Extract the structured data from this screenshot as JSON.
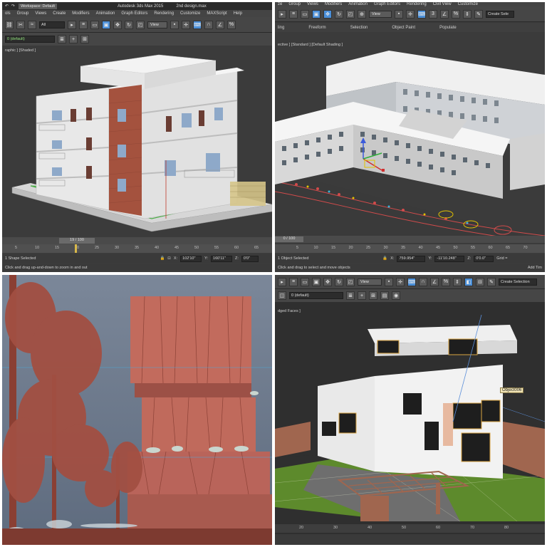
{
  "colors": {
    "viewport_bg": "#3b3b3b",
    "accent": "#4a8fd9",
    "time_slider": "#d8b84a",
    "brick": "#a4523e",
    "render_tint": "#c26b5d"
  },
  "panel1": {
    "workspace": "Workspace: Default",
    "app_title": "Autodesk 3ds Max  2015",
    "file_name": "2nd design.max",
    "menus": [
      "ols",
      "Group",
      "Views",
      "Create",
      "Modifiers",
      "Animation",
      "Graph Editors",
      "Rendering",
      "Customize",
      "MAXScript",
      "Help"
    ],
    "selection_filter": "All",
    "view_dropdown": "View",
    "layer_dropdown": "0 (default)",
    "viewport_label": "raphic ] [Shaded ]",
    "frame_counter": "19 / 100",
    "ruler_ticks": [
      "5",
      "10",
      "15",
      "20",
      "25",
      "30",
      "35",
      "40",
      "45",
      "50",
      "55",
      "60",
      "65"
    ],
    "status_text": "1 Shape Selected",
    "coord_x": "102'10\"",
    "coord_y": "160'11\"",
    "coord_z": "0'0\"",
    "prompt_text": "Click and drag up-and-down to zoom in and out"
  },
  "panel2": {
    "menus": [
      "ze",
      "Group",
      "Views",
      "Modifiers",
      "Animation",
      "Graph Editors",
      "Rendering",
      "Civil View",
      "Customize"
    ],
    "view_dropdown": "View",
    "create_selection": "Create Sele",
    "ribbon_tabs": [
      "ling",
      "Freeform",
      "Selection",
      "Object Paint",
      "Populate"
    ],
    "viewport_label": "ective ] [Standard ] [Default Shading ]",
    "frame_counter": "0 / 100",
    "ruler_ticks": [
      "5",
      "10",
      "15",
      "20",
      "25",
      "30",
      "35",
      "40",
      "45",
      "50",
      "55",
      "60",
      "65",
      "70"
    ],
    "status_text": "1 Object Selected",
    "coord_x": "759.954\"",
    "coord_y": "-11'10.248\"",
    "coord_z": "0'0.0\"",
    "grid_label": "Grid =",
    "prompt_text": "Click and drag to select and move objects",
    "add_time": "Add Tim"
  },
  "panel4": {
    "view_dropdown": "View",
    "create_selection": "Create Selection",
    "layer_dropdown": "0 (default)",
    "viewport_label": "dged Faces ]",
    "object_label": "Object006",
    "ruler_ticks": [
      "20",
      "30",
      "40",
      "50",
      "60",
      "70",
      "80"
    ]
  }
}
